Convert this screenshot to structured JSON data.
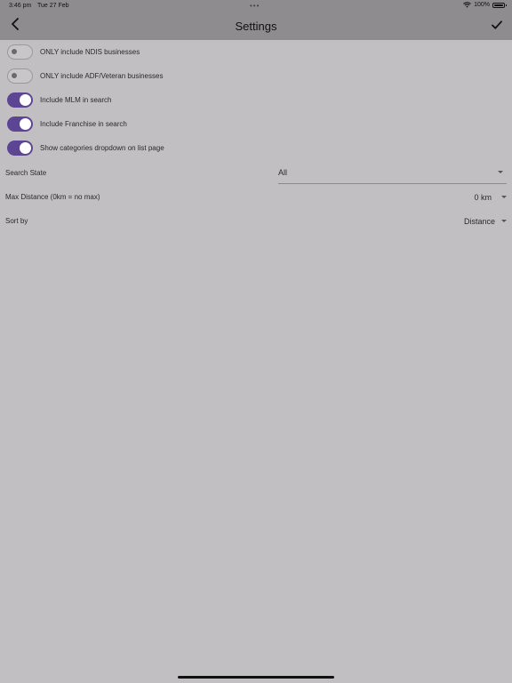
{
  "status_bar": {
    "time": "3:46 pm",
    "date": "Tue 27 Feb",
    "dots": "•••",
    "battery_percent": "100%",
    "wifi_icon": "wifi-icon",
    "battery_icon": "battery-icon"
  },
  "nav": {
    "title": "Settings",
    "back_icon": "chevron-left-icon",
    "save_icon": "checkmark-icon"
  },
  "toggles": [
    {
      "label": "ONLY include NDIS businesses",
      "on": false
    },
    {
      "label": "ONLY include ADF/Veteran businesses",
      "on": false
    },
    {
      "label": "Include MLM in search",
      "on": true
    },
    {
      "label": "Include Franchise in search",
      "on": true
    },
    {
      "label": "Show categories dropdown on list page",
      "on": true
    }
  ],
  "search_state": {
    "label": "Search State",
    "value": "All"
  },
  "max_distance": {
    "label": "Max Distance (0km = no max)",
    "value": "0 km"
  },
  "sort_by": {
    "label": "Sort by",
    "value": "Distance"
  },
  "colors": {
    "accent": "#5c4592",
    "header": "#8f8c8f",
    "background": "#c1bfc1"
  }
}
